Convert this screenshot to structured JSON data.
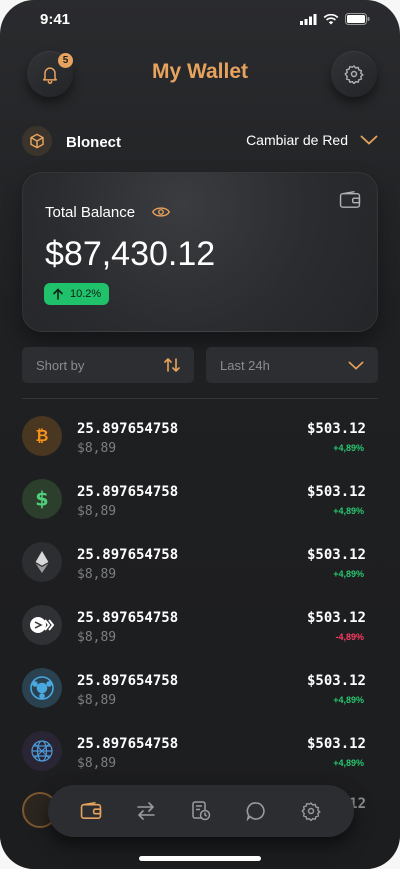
{
  "status_bar": {
    "time": "9:41"
  },
  "header": {
    "title": "My Wallet",
    "notification_count": "5"
  },
  "network": {
    "name": "Blonect",
    "switch_label": "Cambiar de Red"
  },
  "balance": {
    "label": "Total Balance",
    "amount": "$87,430.12",
    "change": "10.2%"
  },
  "filters": {
    "sort_label": "Short by",
    "time_label": "Last 24h"
  },
  "coins": [
    {
      "icon": "bitcoin-icon",
      "amount": "25.897654758",
      "sub": "$8,89",
      "value": "$503.12",
      "change": "+4,89%",
      "trend": "up"
    },
    {
      "icon": "dollar-icon",
      "amount": "25.897654758",
      "sub": "$8,89",
      "value": "$503.12",
      "change": "+4,89%",
      "trend": "up"
    },
    {
      "icon": "ethereum-icon",
      "amount": "25.897654758",
      "sub": "$8,89",
      "value": "$503.12",
      "change": "+4,89%",
      "trend": "up"
    },
    {
      "icon": "coin-logo-icon",
      "amount": "25.897654758",
      "sub": "$8,89",
      "value": "$503.12",
      "change": "-4,89%",
      "trend": "down"
    },
    {
      "icon": "network-coin-icon",
      "amount": "25.897654758",
      "sub": "$8,89",
      "value": "$503.12",
      "change": "+4,89%",
      "trend": "up"
    },
    {
      "icon": "globe-coin-icon",
      "amount": "25.897654758",
      "sub": "$8,89",
      "value": "$503.12",
      "change": "+4,89%",
      "trend": "up"
    }
  ],
  "peek_value": "12",
  "nav": [
    "wallet-icon",
    "transfer-icon",
    "history-icon",
    "chat-icon",
    "settings-icon"
  ],
  "colors": {
    "accent": "#e7a35d",
    "positive": "#28c76f",
    "negative": "#ff3a63",
    "background": "#1f2022"
  }
}
